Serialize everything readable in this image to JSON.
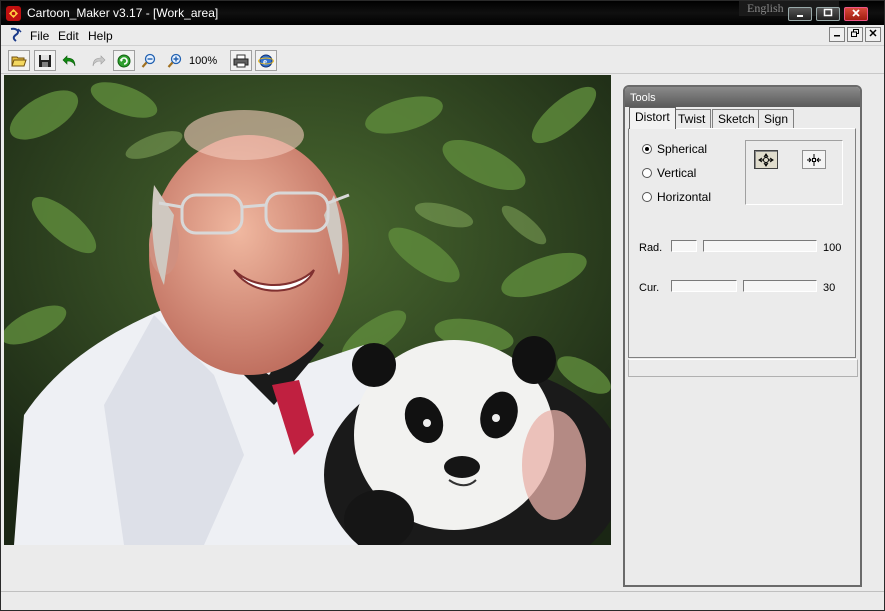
{
  "window": {
    "title": "Cartoon_Maker v3.17 - [Work_area]",
    "language_indicator": "English"
  },
  "menu": {
    "items": [
      {
        "label": "File"
      },
      {
        "label": "Edit"
      },
      {
        "label": "Help"
      }
    ]
  },
  "toolbar": {
    "zoom_level": "100%",
    "buttons": [
      "open-icon",
      "save-icon",
      "undo-icon",
      "redo-icon",
      "refresh-icon",
      "zoom-out-icon",
      "zoom-in-icon",
      "print-icon",
      "web-icon"
    ]
  },
  "tools_panel": {
    "title": "Tools",
    "tabs": [
      {
        "label": "Distort",
        "active": true
      },
      {
        "label": "Twist",
        "active": false
      },
      {
        "label": "Sketch",
        "active": false
      },
      {
        "label": "Sign",
        "active": false
      }
    ],
    "distort": {
      "modes": [
        {
          "label": "Spherical",
          "selected": true
        },
        {
          "label": "Vertical",
          "selected": false
        },
        {
          "label": "Horizontal",
          "selected": false
        }
      ],
      "radius": {
        "label": "Rad.",
        "value": "100"
      },
      "curvature": {
        "label": "Cur.",
        "value": "30"
      }
    }
  },
  "colors": {
    "titlebar": "#000000",
    "close_button": "#c0301f",
    "panel_bg": "#ebebeb"
  }
}
